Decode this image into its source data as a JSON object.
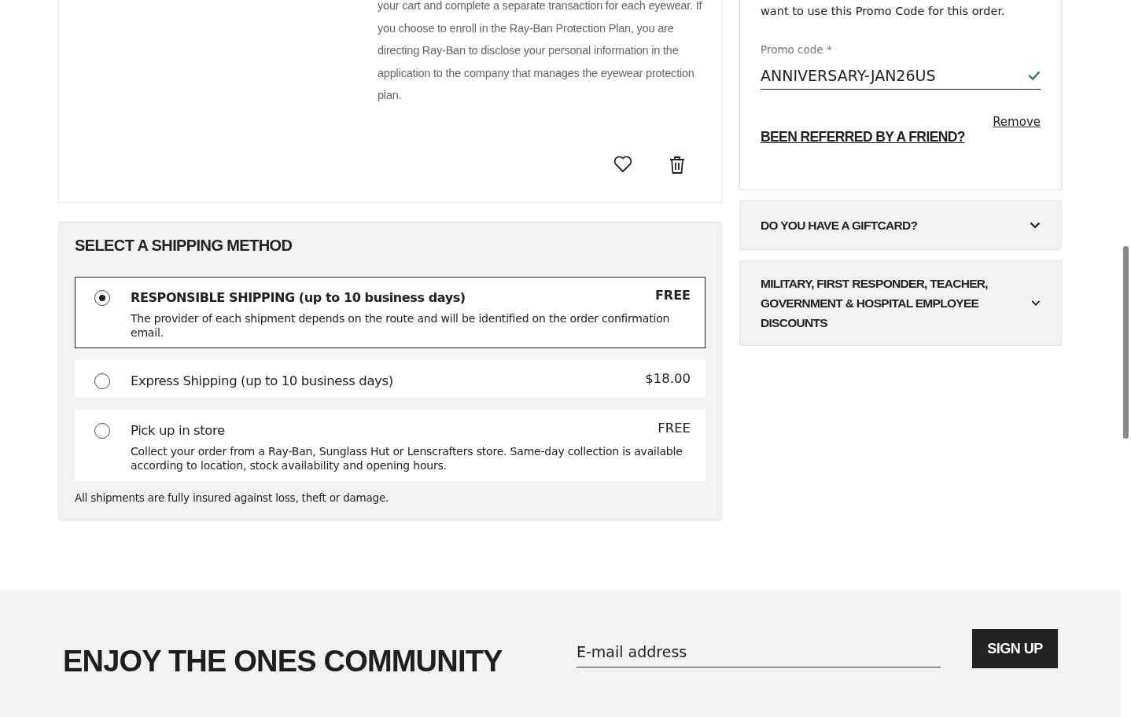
{
  "product_card": {
    "disclaimer": "your cart and complete a separate transaction for each eyewear. If you choose to enroll in the Ray-Ban Protection Plan, you are directing Ray-Ban to disclose your personal information in the application to the company that manages the eyewear protection plan."
  },
  "promo": {
    "note": "want to use this Promo Code for this order.",
    "label": "Promo code *",
    "value": "ANNIVERSARY-JAN26US",
    "valid": true,
    "remove_link": "Remove",
    "referral_link": "BEEN REFERRED BY A FRIEND?"
  },
  "accordions": [
    {
      "title": "DO YOU HAVE A GIFTCARD?",
      "expanded": false
    },
    {
      "title": "MILITARY, FIRST RESPONDER, TEACHER, GOVERNMENT & HOSPITAL EMPLOYEE DISCOUNTS",
      "expanded": false
    }
  ],
  "shipping": {
    "title": "SELECT A SHIPPING METHOD",
    "options": [
      {
        "label": "RESPONSIBLE SHIPPING (up to 10 business days)",
        "price": "FREE",
        "description": "The provider of each shipment depends on the route and will be identified on the order confirmation email.",
        "selected": true
      },
      {
        "label": "Express Shipping (up to 10 business days)",
        "price": "$18.00",
        "selected": false
      },
      {
        "label": "Pick up in store",
        "price": "FREE",
        "description": "Collect your order from a Ray-Ban, Sunglass Hut or Lenscrafters store. Same-day collection is available according to location, stock availability and opening hours.",
        "selected": false
      }
    ],
    "note": "All shipments are fully insured against loss, theft or damage."
  },
  "newsletter": {
    "heading_lines": [
      "ENJOY THE ONES COMMUNITY"
    ],
    "email": {
      "placeholder": "E-mail address"
    },
    "button": "SIGN UP"
  }
}
